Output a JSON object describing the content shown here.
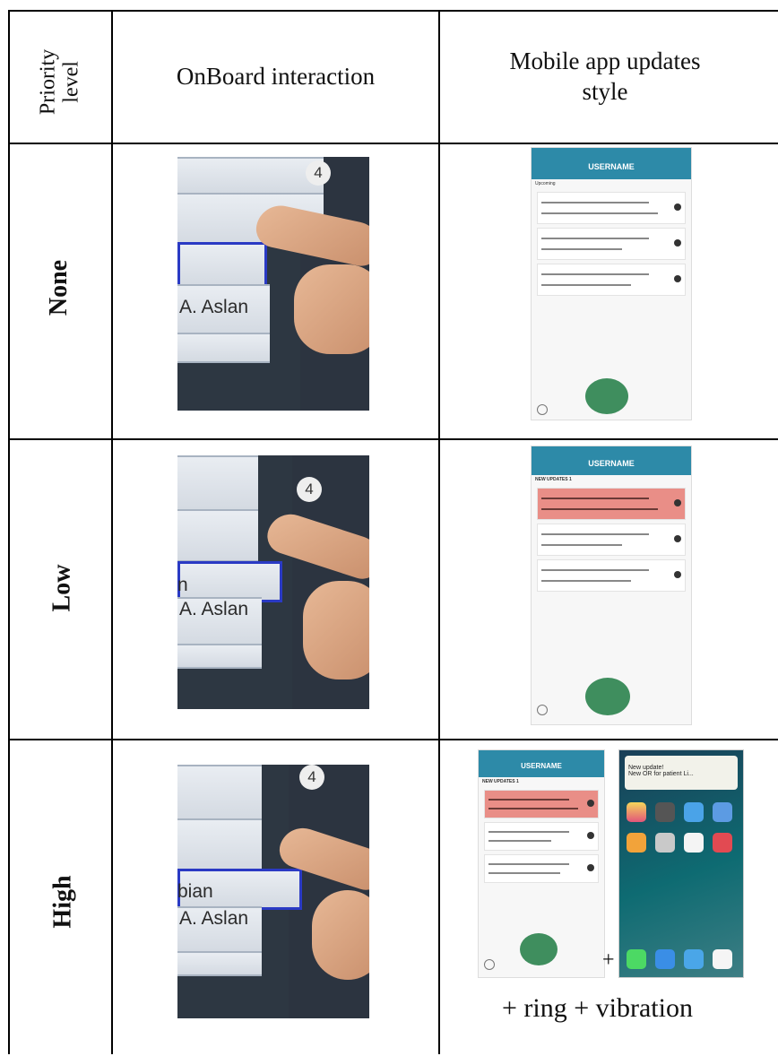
{
  "table": {
    "headers": {
      "priority": "Priority level",
      "onboard": "OnBoard interaction",
      "mobile": "Mobile app updates style"
    },
    "rows": [
      {
        "level": "None",
        "name_label": "A. Aslan"
      },
      {
        "level": "Low",
        "name_label": "A. Aslan",
        "partial_label": "n"
      },
      {
        "level": "High",
        "name_label": "A. Aslan",
        "partial_label": "bian"
      }
    ],
    "mobile": {
      "app_title": "USERNAME",
      "none_subtitle": "Upcoming",
      "updates_subtitle": "NEW UPDATES 1",
      "notification_line1": "New update!",
      "notification_line2": "New OR for patient Li...",
      "plus_sign": "+",
      "high_caption": "+ ring + vibration"
    },
    "photo_digit": "4"
  },
  "colors": {
    "app_header": "#2d8aa8",
    "alert_row": "#e98e87",
    "fab": "#3f8e5e",
    "selection_blue": "#2a3ac4"
  }
}
